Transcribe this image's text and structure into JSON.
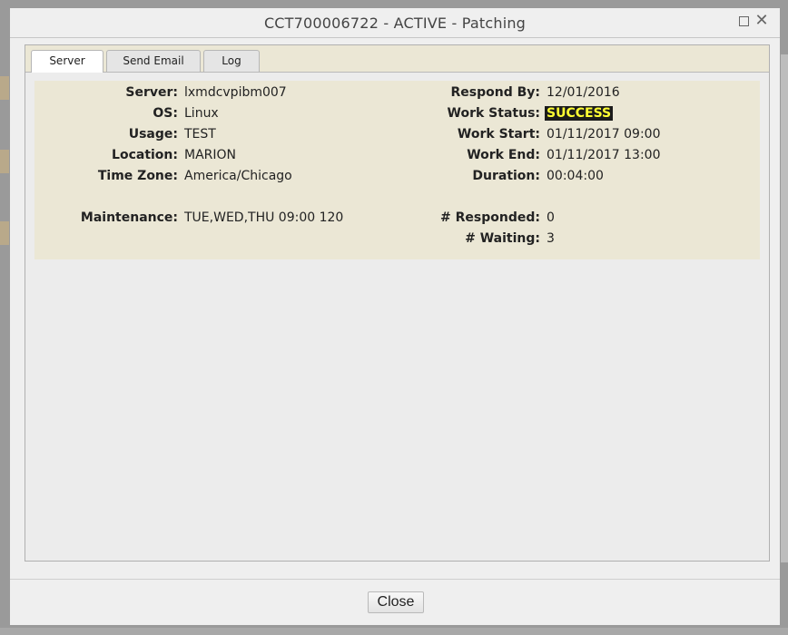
{
  "dialog": {
    "title": "CCT700006722 - ACTIVE - Patching",
    "maximize_icon": "maximize-icon",
    "close_icon": "close-icon"
  },
  "tabs": [
    {
      "label": "Server",
      "active": true
    },
    {
      "label": "Send Email",
      "active": false
    },
    {
      "label": "Log",
      "active": false
    }
  ],
  "left_fields": [
    {
      "label": "Server:",
      "value": "lxmdcvpibm007"
    },
    {
      "label": "OS:",
      "value": "Linux"
    },
    {
      "label": "Usage:",
      "value": "TEST"
    },
    {
      "label": "Location:",
      "value": "MARION"
    },
    {
      "label": "Time Zone:",
      "value": "America/Chicago"
    },
    {
      "label": "Maintenance:",
      "value": "TUE,WED,THU 09:00 120"
    }
  ],
  "right_fields": [
    {
      "label": "Respond By:",
      "value": "12/01/2016"
    },
    {
      "label": "Work Status:",
      "value": "SUCCESS"
    },
    {
      "label": "Work Start:",
      "value": "01/11/2017 09:00"
    },
    {
      "label": "Work End:",
      "value": "01/11/2017 13:00"
    },
    {
      "label": "Duration:",
      "value": "00:04:00"
    },
    {
      "label": "# Responded:",
      "value": "0"
    },
    {
      "label": "# Waiting:",
      "value": "3"
    }
  ],
  "colors": {
    "panel_bg": "#ebe7d5",
    "status_bg": "#1b1b1b",
    "status_fg": "#ffff33"
  },
  "footer": {
    "close_label": "Close"
  }
}
